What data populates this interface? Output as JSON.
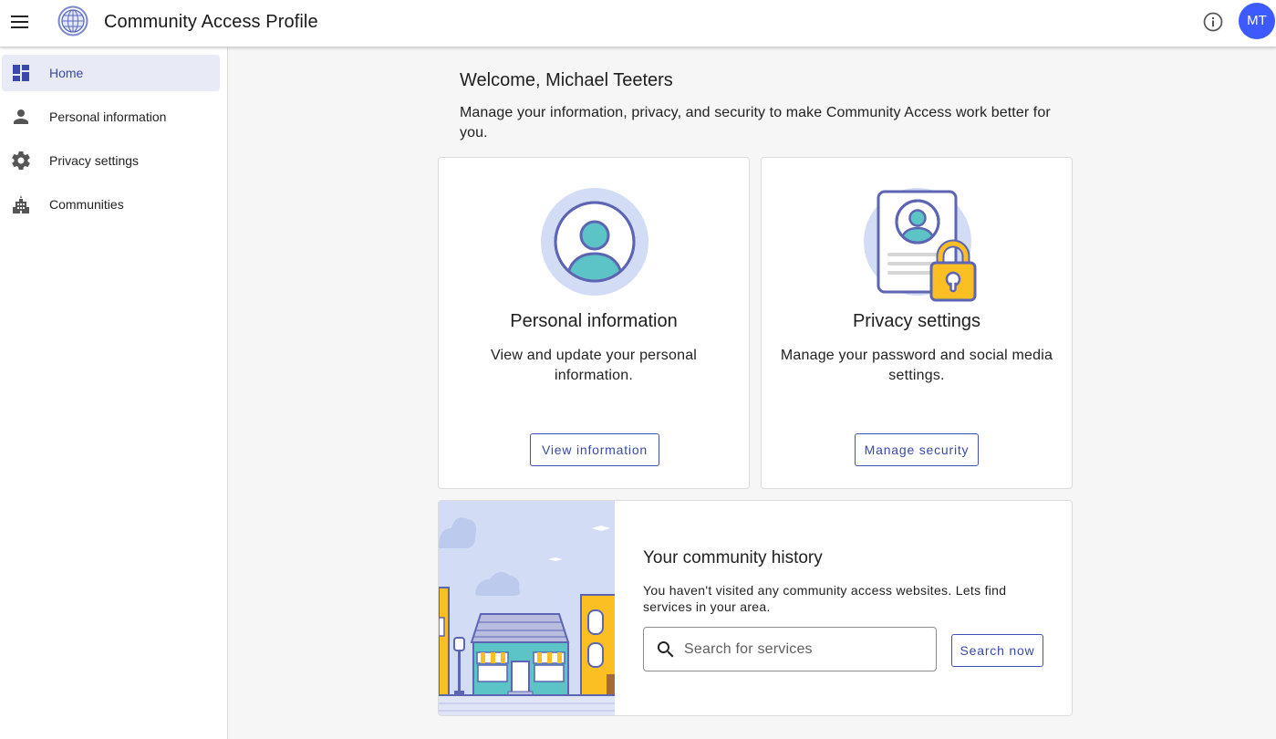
{
  "app": {
    "title": "Community Access Profile"
  },
  "user": {
    "initials": "MT"
  },
  "sidebar": {
    "items": [
      {
        "label": "Home",
        "icon": "dashboard-icon",
        "active": true
      },
      {
        "label": "Personal information",
        "icon": "person-icon",
        "active": false
      },
      {
        "label": "Privacy settings",
        "icon": "gear-icon",
        "active": false
      },
      {
        "label": "Communities",
        "icon": "city-icon",
        "active": false
      }
    ]
  },
  "main": {
    "welcome": "Welcome, Michael Teeters",
    "intro": "Manage your information, privacy, and security to make Community Access work better for you.",
    "cards": [
      {
        "title": "Personal information",
        "description": "View and update your personal information.",
        "button": "View information",
        "icon": "user-profile-icon"
      },
      {
        "title": "Privacy settings",
        "description": "Manage your password and social media settings.",
        "button": "Manage security",
        "icon": "locked-document-icon"
      }
    ],
    "history": {
      "title": "Your community history",
      "text": "You haven't visited any community access websites. Lets find services in your area.",
      "search_placeholder": "Search for services",
      "search_button": "Search now"
    }
  },
  "colors": {
    "accent": "#3f51b5",
    "avatar": "#3d5afe",
    "active_nav_bg": "#e8eaf6",
    "teal": "#5cc4c7",
    "yellow": "#fbbf24"
  }
}
